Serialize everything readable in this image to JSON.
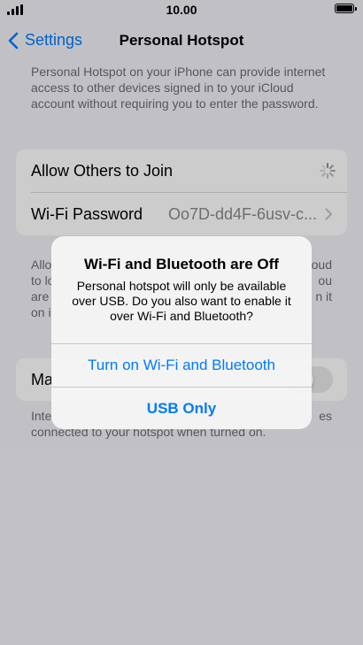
{
  "status": {
    "time": "10.00"
  },
  "nav": {
    "back_label": "Settings",
    "title": "Personal Hotspot"
  },
  "intro": "Personal Hotspot on your iPhone can provide internet access to other devices signed in to your iCloud account without requiring you to enter the password.",
  "settings": {
    "allow_label": "Allow Others to Join",
    "wifi_password_label": "Wi-Fi Password",
    "wifi_password_value": "Oo7D-dd4F-6usv-c..."
  },
  "hidden_text": {
    "line1": "Allo",
    "line1_r": "oud",
    "line2": "to lo",
    "line2_r": "ou",
    "line3": "are",
    "line3_r": "n it",
    "line4": "on i",
    "ma": "Ma",
    "footer1": "Inte",
    "footer1_r": "es",
    "footer2": "connected to your hotspot when turned on."
  },
  "alert": {
    "title": "Wi-Fi and Bluetooth are Off",
    "message": "Personal hotspot will only be available over USB. Do you also want to enable it over Wi-Fi and Bluetooth?",
    "button_primary": "Turn on Wi-Fi and Bluetooth",
    "button_usb": "USB Only"
  },
  "colors": {
    "accent": "#007aff",
    "background": "#f2f2f7"
  }
}
